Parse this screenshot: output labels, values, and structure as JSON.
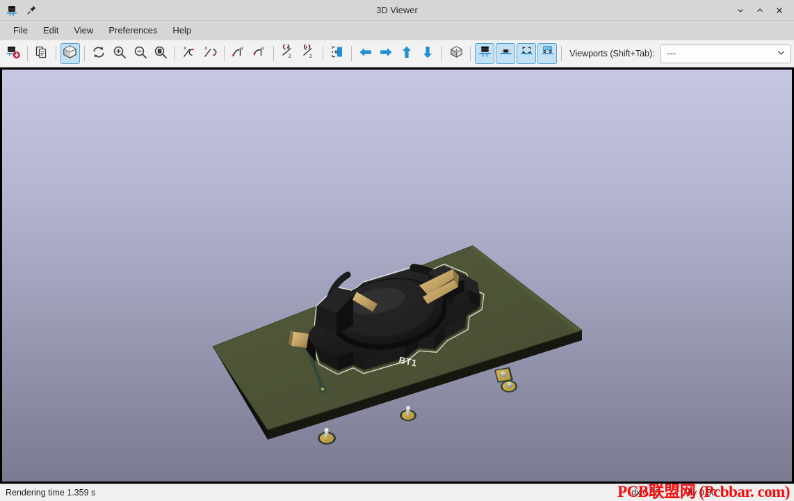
{
  "window": {
    "title": "3D Viewer",
    "app_icon": "pcb-3d-viewer-icon",
    "pin_icon": "pin-icon",
    "minimize_label": "⌄",
    "maximize_label": "⌃",
    "close_label": "✕"
  },
  "menubar": {
    "items": [
      {
        "label": "File",
        "name": "menu-file"
      },
      {
        "label": "Edit",
        "name": "menu-edit"
      },
      {
        "label": "View",
        "name": "menu-view"
      },
      {
        "label": "Preferences",
        "name": "menu-preferences"
      },
      {
        "label": "Help",
        "name": "menu-help"
      }
    ]
  },
  "toolbar": {
    "buttons": [
      {
        "name": "reload-board-button",
        "icon": "reload-board-icon",
        "tooltip": "Reload board and 3D models",
        "active": false
      },
      {
        "name": "copy-image-button",
        "icon": "copy-image-icon",
        "tooltip": "Copy 3D image to clipboard",
        "active": false
      },
      {
        "name": "render-options-button",
        "icon": "render-cube-icon",
        "tooltip": "Render current view using Raytracing",
        "active": true
      },
      {
        "name": "refresh-button",
        "icon": "refresh-icon",
        "tooltip": "Redraw",
        "active": false
      },
      {
        "name": "zoom-in-button",
        "icon": "zoom-in-icon",
        "tooltip": "Zoom in",
        "active": false
      },
      {
        "name": "zoom-out-button",
        "icon": "zoom-out-icon",
        "tooltip": "Zoom out",
        "active": false
      },
      {
        "name": "zoom-fit-button",
        "icon": "zoom-fit-icon",
        "tooltip": "Fit on screen",
        "active": false
      },
      {
        "name": "rotate-x-ccw-button",
        "icon": "rotate-x-ccw-icon",
        "tooltip": "Rotate X Clockwise",
        "active": false
      },
      {
        "name": "rotate-x-cw-button",
        "icon": "rotate-x-cw-icon",
        "tooltip": "Rotate X Counterclockwise",
        "active": false
      },
      {
        "name": "rotate-y-ccw-button",
        "icon": "rotate-y-ccw-icon",
        "tooltip": "Rotate Y Clockwise",
        "active": false
      },
      {
        "name": "rotate-y-cw-button",
        "icon": "rotate-y-cw-icon",
        "tooltip": "Rotate Y Counterclockwise",
        "active": false
      },
      {
        "name": "rotate-z-ccw-button",
        "icon": "rotate-z-ccw-icon",
        "tooltip": "Rotate Z Clockwise",
        "active": false
      },
      {
        "name": "rotate-z-cw-button",
        "icon": "rotate-z-cw-icon",
        "tooltip": "Rotate Z Counterclockwise",
        "active": false
      },
      {
        "name": "flip-board-button",
        "icon": "flip-board-icon",
        "tooltip": "Flip board view",
        "active": false
      },
      {
        "name": "move-left-button",
        "icon": "arrow-left-icon",
        "tooltip": "Move left",
        "active": false
      },
      {
        "name": "move-right-button",
        "icon": "arrow-right-icon",
        "tooltip": "Move right",
        "active": false
      },
      {
        "name": "move-up-button",
        "icon": "arrow-up-icon",
        "tooltip": "Move up",
        "active": false
      },
      {
        "name": "move-down-button",
        "icon": "arrow-down-icon",
        "tooltip": "Move down",
        "active": false
      },
      {
        "name": "toggle-orthographic-button",
        "icon": "orthographic-cube-icon",
        "tooltip": "Enable/disable orthographic projection",
        "active": false
      },
      {
        "name": "show-tht-button",
        "icon": "show-tht-icon",
        "tooltip": "Show 3D through hole models",
        "active": true
      },
      {
        "name": "show-smd-button",
        "icon": "show-smd-icon",
        "tooltip": "Show 3D SMD models",
        "active": true
      },
      {
        "name": "show-virtual-button",
        "icon": "show-virtual-icon",
        "tooltip": "Show 3D unspecified models",
        "active": true
      },
      {
        "name": "show-not-in-pos-button",
        "icon": "show-not-in-pos-icon",
        "tooltip": "Show 3D models not in position file",
        "active": true
      }
    ],
    "viewports_label": "Viewports (Shift+Tab):",
    "viewports_value": "---",
    "viewports_caret": "⌄"
  },
  "canvas": {
    "name": "3d-render-canvas",
    "background_top": "#c6c8e2",
    "background_bottom": "#7a7a91",
    "pcb_color": "#4e5536",
    "pcb_edge_color": "#1b1b14",
    "silkscreen_color": "#e8e8e0",
    "component": {
      "reference": "BT1",
      "body_color": "#1d1d1d",
      "contact_color": "#c8a96a"
    },
    "via_copper_color": "#c9a84e",
    "pin_metal_color": "#c8c8c0"
  },
  "statusbar": {
    "rendering_time": "Rendering time 1.359 s",
    "dx": "dx 0.00",
    "dy": "dy 0.00",
    "watermark": "PCB联盟网 (Pcbbar. com)"
  }
}
